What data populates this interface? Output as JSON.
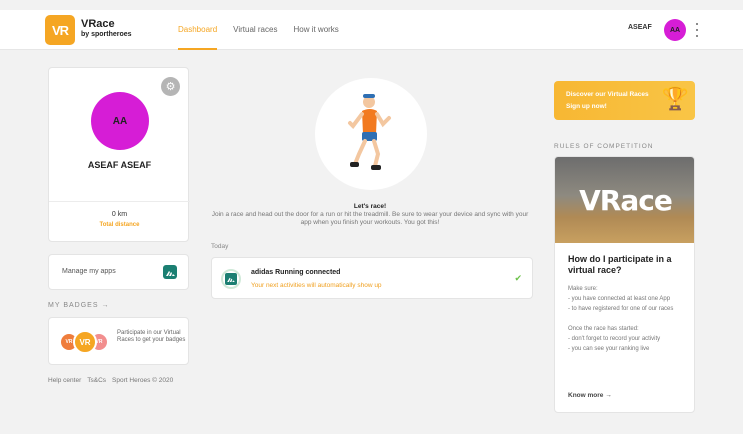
{
  "header": {
    "logo_mark": "VR",
    "logo_title": "VRace",
    "logo_subtitle": "by sportheroes",
    "nav": [
      {
        "label": "Dashboard",
        "active": true
      },
      {
        "label": "Virtual races",
        "active": false
      },
      {
        "label": "How it works",
        "active": false
      }
    ],
    "user_name": "ASEAF",
    "user_initials": "AA"
  },
  "profile": {
    "initials": "AA",
    "name": "ASEAF ASEAF",
    "distance": "0 km",
    "distance_label": "Total distance"
  },
  "apps": {
    "label": "Manage my apps"
  },
  "badges": {
    "heading": "MY BADGES →",
    "badge_left": "VR",
    "badge_mid": "VR",
    "badge_right": "VR",
    "text": "Participate in our Virtual Races to get your badges"
  },
  "footer": {
    "help": "Help center",
    "terms": "Ts&Cs",
    "copyright": "Sport Heroes © 2020"
  },
  "center": {
    "title": "Let's race!",
    "description": "Join a race and head out the door for a run or hit the treadmill. Be sure to wear your device and sync with your app when you finish your workouts. You got this!",
    "today_label": "Today",
    "activity_title": "adidas Running connected",
    "activity_subtitle": "Your next activities will automatically show up"
  },
  "promo": {
    "line1": "Discover our Virtual Races",
    "line2": "Sign up now!"
  },
  "rules": {
    "heading": "RULES OF COMPETITION",
    "image_text": "VRace",
    "question": "How do I participate in a virtual race?",
    "body_lines": [
      "Make sure:",
      "- you have connected at least one App",
      "- to have registered for one of our races",
      "",
      "Once the race has started:",
      "- don't forget to record your activity",
      "- you can see your ranking live"
    ],
    "know_more": "Know more →"
  },
  "colors": {
    "accent": "#f5a623",
    "avatar": "#d61dd6",
    "adidas": "#1b7f72",
    "check": "#6cc24a"
  }
}
